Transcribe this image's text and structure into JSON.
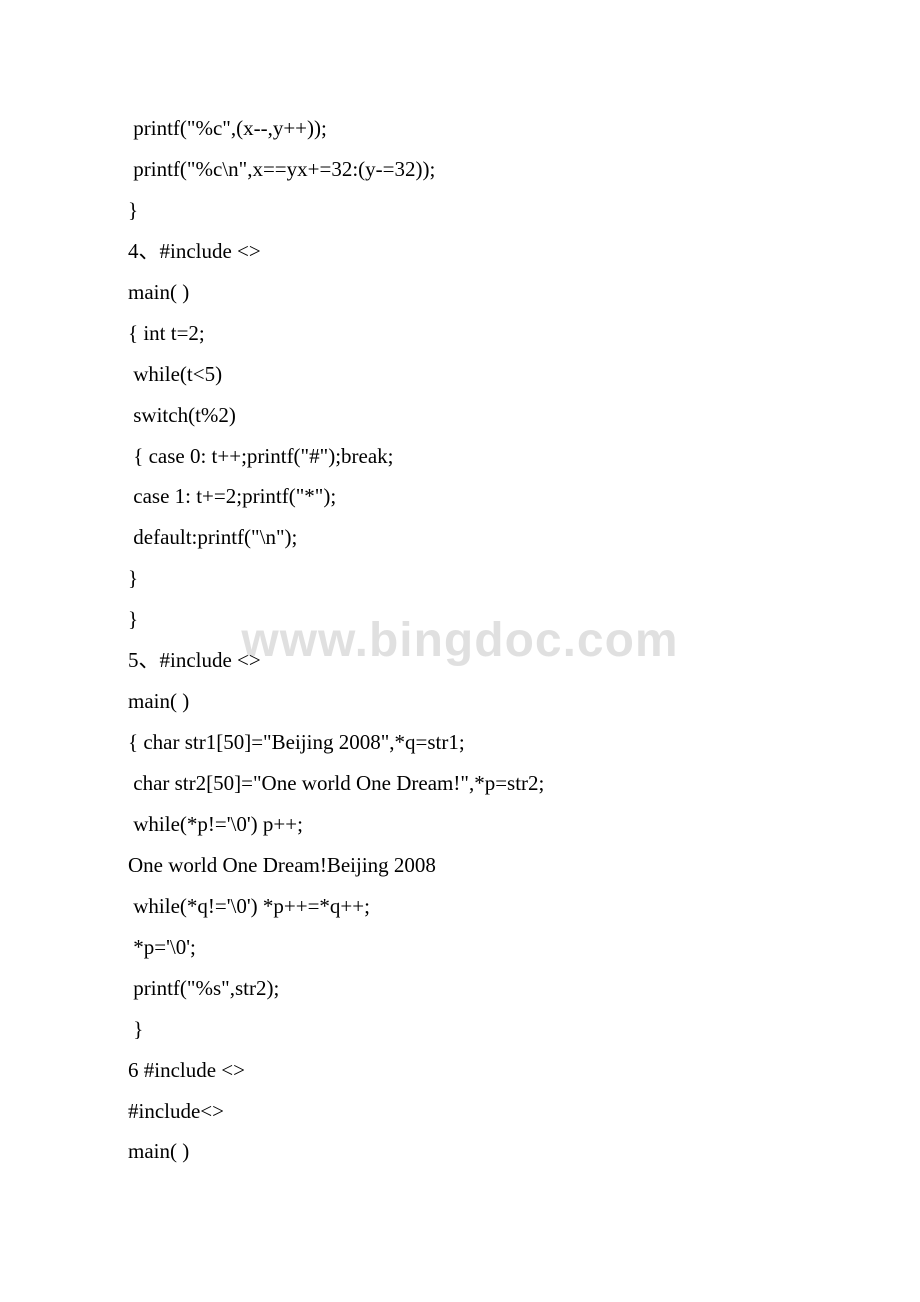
{
  "lines": [
    " printf(\"%c\",(x--,y++));",
    " printf(\"%c\\n\",x==yx+=32:(y-=32));",
    "}",
    "4、#include <>",
    "main( )",
    "{ int t=2;",
    " while(t<5)",
    " switch(t%2)",
    " { case 0: t++;printf(\"#\");break;",
    " case 1: t+=2;printf(\"*\");",
    " default:printf(\"\\n\");",
    "}",
    "}",
    "5、#include <>",
    "main( )",
    "{ char str1[50]=\"Beijing 2008\",*q=str1;",
    " char str2[50]=\"One world One Dream!\",*p=str2;",
    " while(*p!='\\0') p++;",
    "One world One Dream!Beijing 2008",
    " while(*q!='\\0') *p++=*q++;",
    " *p='\\0';",
    " printf(\"%s\",str2);",
    " }",
    "6 #include <>",
    "#include<>",
    "main( )"
  ],
  "watermark": "www.bingdoc.com"
}
